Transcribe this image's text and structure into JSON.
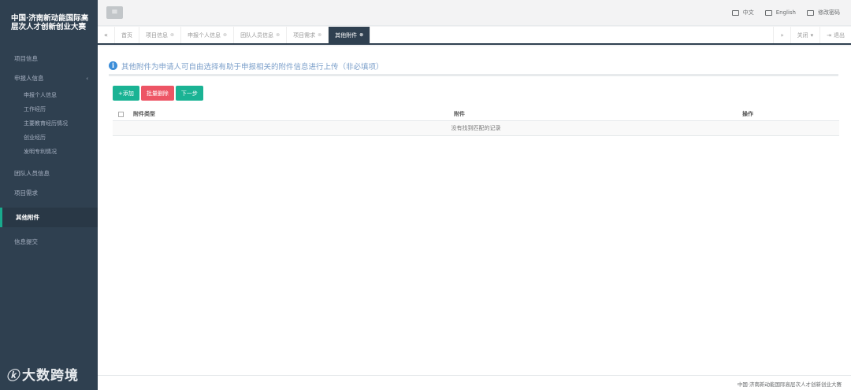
{
  "app": {
    "brand_line1": "中国·济南新动能国际高",
    "brand_line2": "层次人才创新创业大赛"
  },
  "sidebar": {
    "items": [
      {
        "label": "项目信息"
      },
      {
        "label": "申报人信息",
        "arrow": "‹",
        "children": [
          "申报个人信息",
          "工作经历",
          "主要教育经历情况",
          "创业经历",
          "发明专利情况"
        ]
      },
      {
        "label": "团队人员信息"
      },
      {
        "label": "项目需求"
      },
      {
        "label": "其他附件",
        "active": true
      },
      {
        "label": "信息提交"
      }
    ]
  },
  "watermark": {
    "logo": "ⓚ",
    "text": "大数跨境"
  },
  "topbar": {
    "menu_icon": "≡",
    "links": [
      {
        "label": "中文",
        "icon": "flag-icon"
      },
      {
        "label": "English",
        "icon": "flag-icon"
      },
      {
        "label": "修改密码",
        "icon": "password-icon"
      }
    ]
  },
  "tabs": {
    "prev": "«",
    "next": "»",
    "items": [
      {
        "label": "首页",
        "closable": false
      },
      {
        "label": "项目信息",
        "closable": true
      },
      {
        "label": "申报个人信息",
        "closable": true
      },
      {
        "label": "团队人员信息",
        "closable": true
      },
      {
        "label": "项目需求",
        "closable": true
      },
      {
        "label": "其他附件",
        "closable": true,
        "active": true
      }
    ],
    "close_glyph": "⊗",
    "close_menu": "关闭",
    "logout": "退出"
  },
  "notice": {
    "icon": "i",
    "text": "其他附件为申请人可自由选择有助于申报相关的附件信息进行上传（非必填项）"
  },
  "buttons": {
    "add": "+添加",
    "batch_delete": "批量删除",
    "next": "下一步"
  },
  "table": {
    "headers": [
      "附件类型",
      "附件",
      "操作"
    ],
    "empty_text": "没有找到匹配的记录"
  },
  "footer": {
    "text": "中国·济南新动能国际高层次人才创新创业大赛"
  },
  "colors": {
    "sidebar": "#2f4050",
    "accent": "#1ab394",
    "danger": "#ed5565",
    "info": "#3b8dd8"
  }
}
